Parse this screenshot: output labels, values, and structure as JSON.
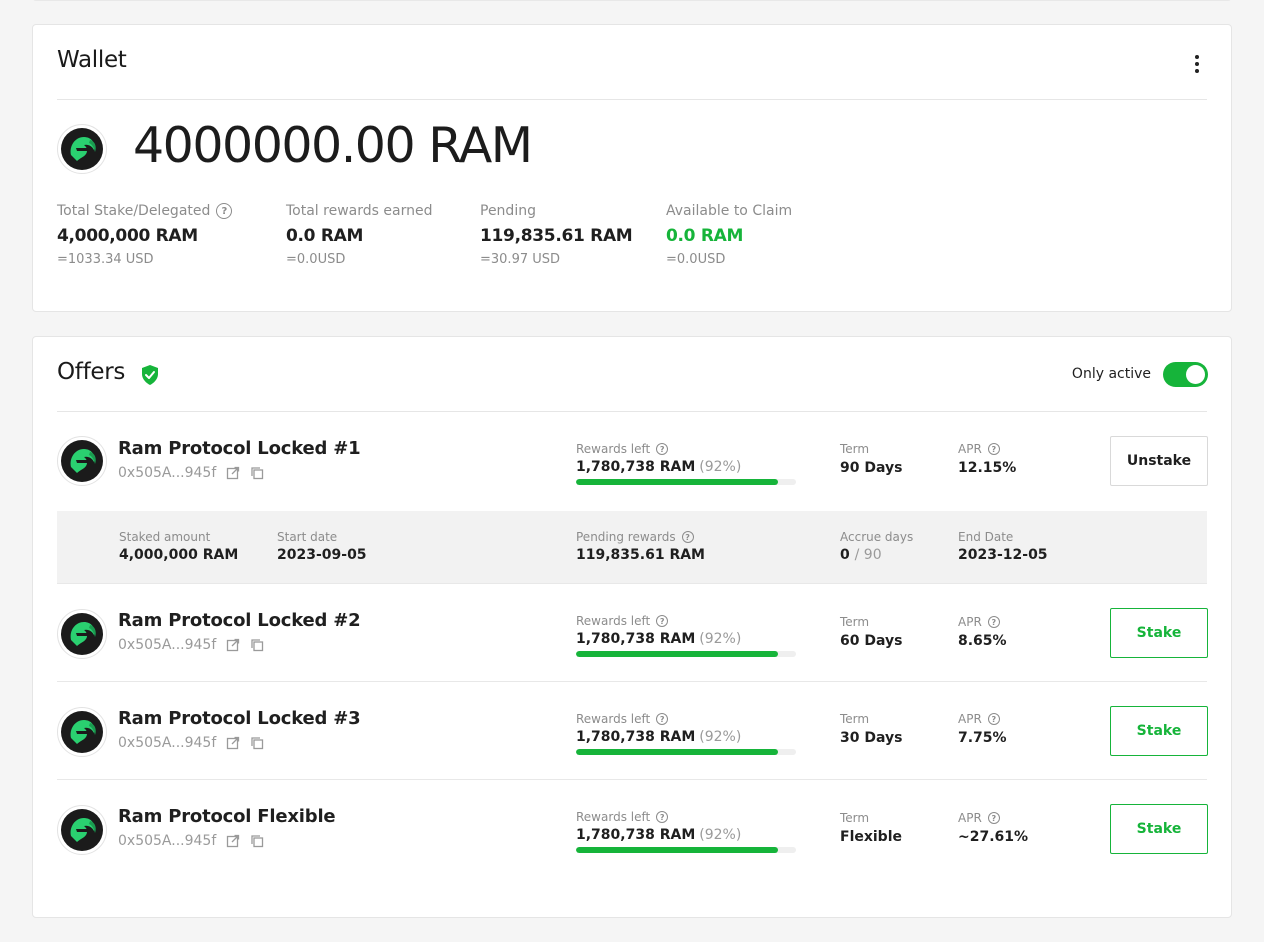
{
  "colors": {
    "accent": "#16b43a",
    "muted": "#8c8c8c",
    "text": "#1f1f1f"
  },
  "wallet": {
    "title": "Wallet",
    "balance": "4000000.00 RAM",
    "stats": [
      {
        "label": "Total Stake/Delegated",
        "value": "4,000,000 RAM",
        "usd": "=1033.34 USD",
        "has_help": true
      },
      {
        "label": "Total rewards earned",
        "value": "0.0 RAM",
        "usd": "=0.0USD"
      },
      {
        "label": "Pending",
        "value": "119,835.61 RAM",
        "usd": "=30.97 USD"
      },
      {
        "label": "Available to Claim",
        "value": "0.0 RAM",
        "usd": "=0.0USD",
        "highlight": "green"
      }
    ]
  },
  "offers": {
    "title": "Offers",
    "toggle": {
      "label": "Only active",
      "on": true
    },
    "items": [
      {
        "name": "Ram Protocol Locked #1",
        "address": "0x505A...945f",
        "rewards_label": "Rewards left",
        "rewards_amount": "1,780,738 RAM",
        "rewards_pct": "(92%)",
        "rewards_fraction": 0.92,
        "term_label": "Term",
        "term": "90 Days",
        "apr_label": "APR",
        "apr": "12.15%",
        "button": "Unstake"
      },
      {
        "name": "Ram Protocol Locked #2",
        "address": "0x505A...945f",
        "rewards_label": "Rewards left",
        "rewards_amount": "1,780,738 RAM",
        "rewards_pct": "(92%)",
        "rewards_fraction": 0.92,
        "term_label": "Term",
        "term": "60 Days",
        "apr_label": "APR",
        "apr": "8.65%",
        "button": "Stake"
      },
      {
        "name": "Ram Protocol Locked #3",
        "address": "0x505A...945f",
        "rewards_label": "Rewards left",
        "rewards_amount": "1,780,738 RAM",
        "rewards_pct": "(92%)",
        "rewards_fraction": 0.92,
        "term_label": "Term",
        "term": "30 Days",
        "apr_label": "APR",
        "apr": "7.75%",
        "button": "Stake"
      },
      {
        "name": "Ram Protocol Flexible",
        "address": "0x505A...945f",
        "rewards_label": "Rewards left",
        "rewards_amount": "1,780,738 RAM",
        "rewards_pct": "(92%)",
        "rewards_fraction": 0.92,
        "term_label": "Term",
        "term": "Flexible",
        "apr_label": "APR",
        "apr": "~27.61%",
        "button": "Stake"
      }
    ],
    "details": {
      "staked_label": "Staked amount",
      "staked": "4,000,000 RAM",
      "start_label": "Start date",
      "start": "2023-09-05",
      "pending_label": "Pending rewards",
      "pending": "119,835.61 RAM",
      "accrue_label": "Accrue days",
      "accrue_current": "0",
      "accrue_total": "/ 90",
      "end_label": "End Date",
      "end": "2023-12-05"
    }
  }
}
